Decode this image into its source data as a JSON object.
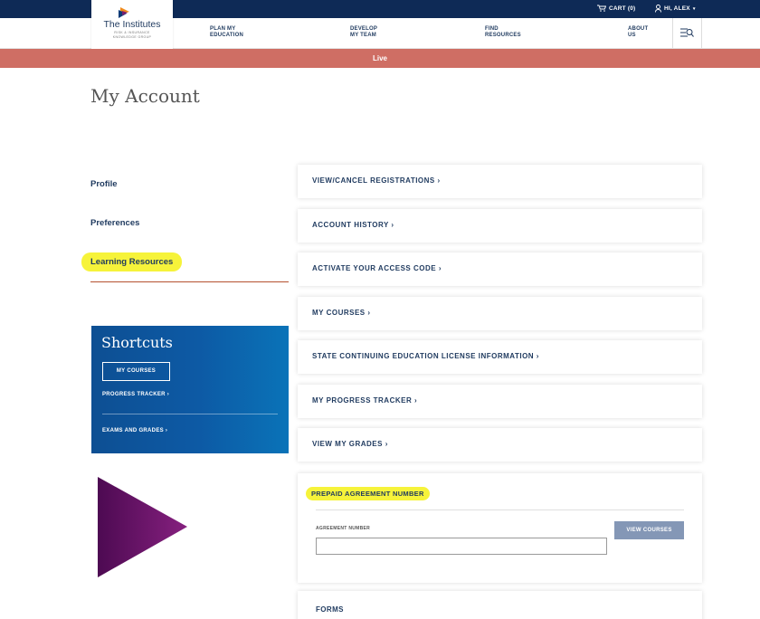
{
  "topbar": {
    "cart_label": "CART (0)",
    "user_label": "HI, ALEX"
  },
  "logo": {
    "name": "The Institutes",
    "sub_line1": "RISK & INSURANCE",
    "sub_line2": "KNOWLEDGE GROUP"
  },
  "nav": {
    "items": [
      {
        "line1": "PLAN MY",
        "line2": "EDUCATION"
      },
      {
        "line1": "DEVELOP",
        "line2": "MY TEAM"
      },
      {
        "line1": "FIND",
        "line2": "RESOURCES"
      },
      {
        "line1": "ABOUT",
        "line2": "US"
      }
    ]
  },
  "banner": {
    "text": "Live"
  },
  "page": {
    "title": "My Account"
  },
  "leftnav": {
    "items": [
      "Profile",
      "Preferences",
      "Learning Resources"
    ],
    "highlighted": "Learning Resources"
  },
  "shortcuts": {
    "title": "Shortcuts",
    "button": "MY COURSES",
    "links": [
      "PROGRESS TRACKER  ›",
      "EXAMS AND GRADES  ›"
    ]
  },
  "cards": [
    "VIEW/CANCEL REGISTRATIONS ›",
    "ACCOUNT HISTORY ›",
    "ACTIVATE YOUR ACCESS CODE ›",
    "MY COURSES ›",
    "STATE CONTINUING EDUCATION LICENSE INFORMATION ›",
    "MY PROGRESS TRACKER ›",
    "VIEW MY GRADES ›"
  ],
  "prepaid": {
    "title": "PREPAID AGREEMENT NUMBER",
    "field_label": "AGREEMENT NUMBER",
    "field_value": "",
    "button": "VIEW COURSES"
  },
  "forms": {
    "label": "FORMS"
  },
  "colors": {
    "navy": "#0e2a56",
    "banner": "#cf6e64",
    "highlight": "#f6f33a",
    "shortcuts_blue": "#0d5aa5",
    "purple": "#6b1470"
  }
}
